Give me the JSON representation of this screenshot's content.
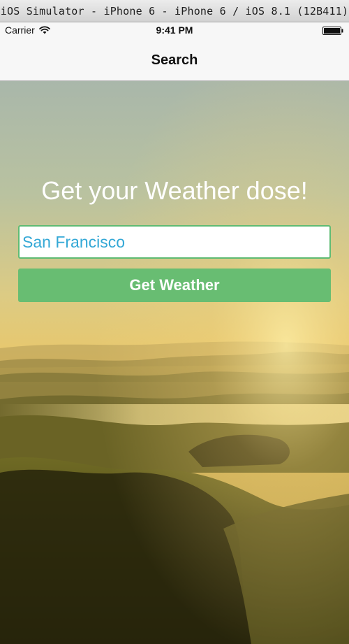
{
  "simulator": {
    "window_title": "iOS Simulator - iPhone 6 - iPhone 6 / iOS 8.1 (12B411)"
  },
  "status_bar": {
    "carrier": "Carrier",
    "time": "9:41 PM",
    "wifi_icon": "wifi-icon",
    "battery_icon": "battery-icon",
    "battery_level": 1.0
  },
  "nav_bar": {
    "title": "Search"
  },
  "main": {
    "headline": "Get your Weather dose!",
    "city_input": {
      "value": "San Francisco",
      "placeholder": ""
    },
    "submit_label": "Get Weather"
  },
  "colors": {
    "accent_green": "#68bd72",
    "input_border": "#5fbb73",
    "input_text": "#34a8d6",
    "headline_text": "#ffffff"
  }
}
